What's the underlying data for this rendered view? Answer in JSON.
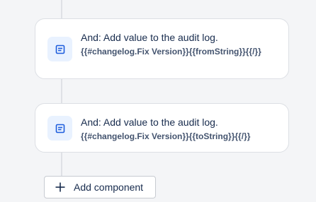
{
  "rules": [
    {
      "icon": "note-icon",
      "title": "And: Add value to the audit log.",
      "code": "{{#changelog.Fix Version}}{{fromString}}{{/}}"
    },
    {
      "icon": "note-icon",
      "title": "And: Add value to the audit log.",
      "code": "{{#changelog.Fix Version}}{{toString}}{{/}}"
    }
  ],
  "add_component": {
    "icon": "plus-icon",
    "label": "Add component"
  },
  "colors": {
    "background": "#f4f5f7",
    "icon_bg": "#e9f2ff",
    "icon_stroke": "#1d5ddd",
    "connector": "#dfe1e6",
    "title_text": "#172b4d",
    "code_text": "#44546f"
  }
}
